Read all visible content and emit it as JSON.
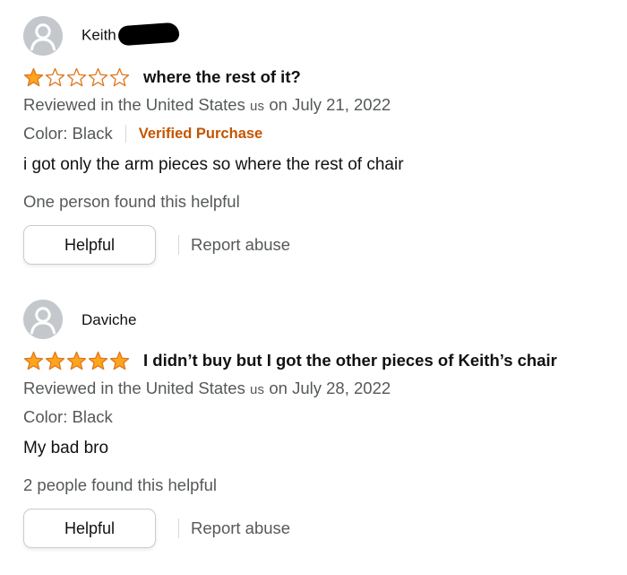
{
  "colors": {
    "star_fill": "#ffa41c",
    "star_outline": "#de7921",
    "verified": "#c45500",
    "meta_text": "#565959",
    "avatar_bg": "#c4c8cc"
  },
  "reviews": [
    {
      "profile_name": "Keith",
      "name_redacted": true,
      "avatar_icon": "default-user-avatar-icon",
      "rating": 1,
      "rating_max": 5,
      "title": "where the rest of it?",
      "reviewed_in": "Reviewed in the United States",
      "country_code": "us",
      "date_text": "on July 21, 2022",
      "color_label": "Color: Black",
      "verified_label": "Verified Purchase",
      "body": "i got only the arm pieces so where the rest of chair",
      "helpful_count_text": "One person found this helpful",
      "helpful_button": "Helpful",
      "report_link": "Report abuse"
    },
    {
      "profile_name": "Daviche",
      "avatar_icon": "default-user-avatar-icon",
      "rating": 5,
      "rating_max": 5,
      "title": "I didn’t buy but I got the other pieces of Keith’s chair",
      "reviewed_in": "Reviewed in the United States",
      "country_code": "us",
      "date_text": "on July 28, 2022",
      "color_label": "Color: Black",
      "body": "My bad bro",
      "helpful_count_text": "2 people found this helpful",
      "helpful_button": "Helpful",
      "report_link": "Report abuse"
    }
  ]
}
